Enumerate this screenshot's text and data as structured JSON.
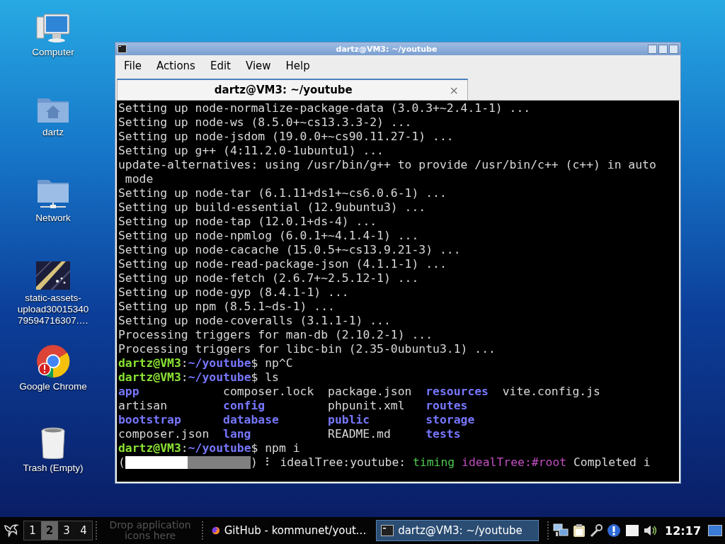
{
  "desktop_icons": [
    {
      "label": "Computer",
      "kind": "computer"
    },
    {
      "label": "dartz",
      "kind": "home"
    },
    {
      "label": "Network",
      "kind": "network"
    },
    {
      "label": "static-assets-upload3001534079594716307.…",
      "kind": "picture"
    },
    {
      "label": "Google Chrome",
      "kind": "browser"
    },
    {
      "label": "Trash (Empty)",
      "kind": "trash"
    }
  ],
  "window": {
    "title": "dartz@VM3: ~/youtube",
    "menu": [
      "File",
      "Actions",
      "Edit",
      "View",
      "Help"
    ],
    "tabs": [
      {
        "label": "dartz@VM3: ~/youtube",
        "selected": true,
        "close": "×"
      }
    ],
    "lines": [
      {
        "kind": "text",
        "text": "Setting up node-normalize-package-data (3.0.3+~2.4.1-1) ..."
      },
      {
        "kind": "text",
        "text": "Setting up node-ws (8.5.0+~cs13.3.3-2) ..."
      },
      {
        "kind": "text",
        "text": "Setting up node-jsdom (19.0.0+~cs90.11.27-1) ..."
      },
      {
        "kind": "text",
        "text": "Setting up g++ (4:11.2.0-1ubuntu1) ..."
      },
      {
        "kind": "text",
        "text": "update-alternatives: using /usr/bin/g++ to provide /usr/bin/c++ (c++) in auto"
      },
      {
        "kind": "text",
        "text": " mode"
      },
      {
        "kind": "text",
        "text": "Setting up node-tar (6.1.11+ds1+~cs6.0.6-1) ..."
      },
      {
        "kind": "text",
        "text": "Setting up build-essential (12.9ubuntu3) ..."
      },
      {
        "kind": "text",
        "text": "Setting up node-tap (12.0.1+ds-4) ..."
      },
      {
        "kind": "text",
        "text": "Setting up node-npmlog (6.0.1+~4.1.4-1) ..."
      },
      {
        "kind": "text",
        "text": "Setting up node-cacache (15.0.5+~cs13.9.21-3) ..."
      },
      {
        "kind": "text",
        "text": "Setting up node-read-package-json (4.1.1-1) ..."
      },
      {
        "kind": "text",
        "text": "Setting up node-fetch (2.6.7+~2.5.12-1) ..."
      },
      {
        "kind": "text",
        "text": "Setting up node-gyp (8.4.1-1) ..."
      },
      {
        "kind": "text",
        "text": "Setting up npm (8.5.1~ds-1) ..."
      },
      {
        "kind": "text",
        "text": "Setting up node-coveralls (3.1.1-1) ..."
      },
      {
        "kind": "text",
        "text": "Processing triggers for man-db (2.10.2-1) ..."
      },
      {
        "kind": "text",
        "text": "Processing triggers for libc-bin (2.35-0ubuntu3.1) ..."
      },
      {
        "kind": "prompt",
        "user": "dartz@VM3",
        "sep": ":",
        "path": "~/youtube",
        "symbol": "$",
        "command": "np^C"
      },
      {
        "kind": "prompt",
        "user": "dartz@VM3",
        "sep": ":",
        "path": "~/youtube",
        "symbol": "$",
        "command": "ls"
      },
      {
        "kind": "ls",
        "rows": [
          [
            {
              "name": "app",
              "kind": "dir"
            },
            {
              "name": "composer.lock",
              "kind": "file"
            },
            {
              "name": "package.json",
              "kind": "file"
            },
            {
              "name": "resources",
              "kind": "dir"
            },
            {
              "name": "vite.config.js",
              "kind": "file"
            }
          ],
          [
            {
              "name": "artisan",
              "kind": "file"
            },
            {
              "name": "config",
              "kind": "dir"
            },
            {
              "name": "phpunit.xml",
              "kind": "file"
            },
            {
              "name": "routes",
              "kind": "dir"
            }
          ],
          [
            {
              "name": "bootstrap",
              "kind": "dir"
            },
            {
              "name": "database",
              "kind": "dir"
            },
            {
              "name": "public",
              "kind": "dir"
            },
            {
              "name": "storage",
              "kind": "dir"
            }
          ],
          [
            {
              "name": "composer.json",
              "kind": "file"
            },
            {
              "name": "lang",
              "kind": "dir"
            },
            {
              "name": "README.md",
              "kind": "file"
            },
            {
              "name": "tests",
              "kind": "dir"
            }
          ]
        ]
      },
      {
        "kind": "prompt",
        "user": "dartz@VM3",
        "sep": ":",
        "path": "~/youtube",
        "symbol": "$",
        "command": "npm i"
      },
      {
        "kind": "progress",
        "open": "(",
        "close": ")",
        "level": 0.5,
        "spinner": "⠇",
        "segments": [
          {
            "text": "idealTree:youtube:",
            "kind": "plain"
          },
          {
            "text": "timing",
            "kind": "green"
          },
          {
            "text": "idealTree:#root",
            "kind": "magenta"
          },
          {
            "text": "Completed i",
            "kind": "plain"
          }
        ]
      }
    ]
  },
  "taskbar": {
    "workspaces": [
      {
        "label": "1",
        "selected": false
      },
      {
        "label": "2",
        "selected": true
      },
      {
        "label": "3",
        "selected": false
      },
      {
        "label": "4",
        "selected": false
      }
    ],
    "launcher_hint": "Drop application icons here",
    "tasks": [
      {
        "label": "GitHub - kommunet/yout...",
        "kind": "browser",
        "selected": false
      },
      {
        "label": "dartz@VM3: ~/youtube",
        "kind": "terminal",
        "selected": true
      }
    ],
    "clock": "12:17"
  }
}
